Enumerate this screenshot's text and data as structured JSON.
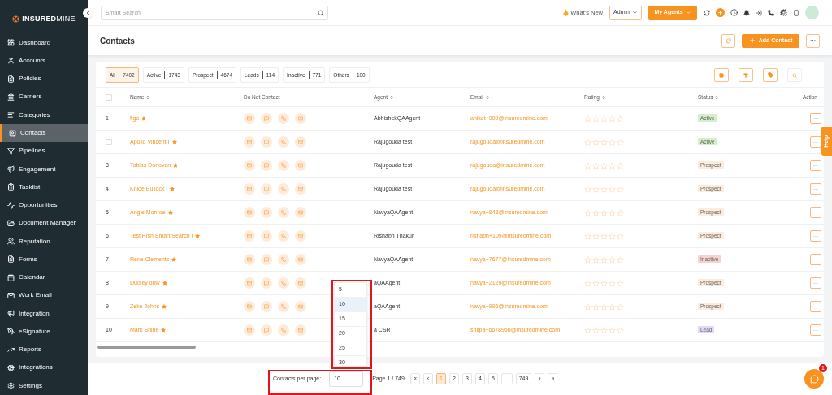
{
  "brand": {
    "name_bold": "INSURED",
    "name_light": "MINE"
  },
  "sidebar": {
    "items": [
      {
        "label": "Dashboard",
        "selected": false
      },
      {
        "label": "Accounts",
        "selected": false
      },
      {
        "label": "Policies",
        "selected": false
      },
      {
        "label": "Carriers",
        "selected": false
      },
      {
        "label": "Categories",
        "selected": false
      },
      {
        "label": "Contacts",
        "selected": true
      },
      {
        "label": "Pipelines",
        "selected": false
      },
      {
        "label": "Engagement",
        "selected": false
      },
      {
        "label": "Tasklist",
        "selected": false
      },
      {
        "label": "Opportunities",
        "selected": false
      },
      {
        "label": "Document Manager",
        "selected": false
      },
      {
        "label": "Reputation",
        "selected": false
      },
      {
        "label": "Forms",
        "selected": false
      },
      {
        "label": "Calendar",
        "selected": false
      },
      {
        "label": "Work Email",
        "selected": false
      },
      {
        "label": "Integration",
        "selected": false
      },
      {
        "label": "eSignature",
        "selected": false
      },
      {
        "label": "Reports",
        "selected": false
      },
      {
        "label": "Integrations",
        "selected": false
      },
      {
        "label": "Settings",
        "selected": false
      }
    ]
  },
  "topbar": {
    "search_placeholder": "Smart Search",
    "whats_new": "What's New",
    "role_select": "Admin",
    "agents_button": "My Agents"
  },
  "page": {
    "title": "Contacts",
    "add_button": "Add Contact",
    "more_button": "···"
  },
  "filters": [
    {
      "label": "All",
      "count": "7402",
      "selected": true
    },
    {
      "label": "Active",
      "count": "1743",
      "selected": false
    },
    {
      "label": "Prospect",
      "count": "4674",
      "selected": false
    },
    {
      "label": "Leads",
      "count": "114",
      "selected": false
    },
    {
      "label": "Inactive",
      "count": "771",
      "selected": false
    },
    {
      "label": "Others",
      "count": "100",
      "selected": false
    }
  ],
  "table": {
    "select_all": {
      "checked": false
    },
    "columns": [
      {
        "label": "Name",
        "sortable": true
      },
      {
        "label": "Do Not Contact",
        "sortable": false
      },
      {
        "label": "Agent",
        "sortable": true
      },
      {
        "label": "Email",
        "sortable": true
      },
      {
        "label": "Rating",
        "sortable": true
      },
      {
        "label": "Status",
        "sortable": true
      },
      {
        "label": "Action",
        "sortable": false
      }
    ],
    "rows": [
      {
        "kind": "number",
        "index": "1",
        "name": "figo",
        "agent": "AbhishekQAAgent",
        "email": "aniket+900@insuredmine.com",
        "stars": 0,
        "status": "Active",
        "color": "#d4f0c8"
      },
      {
        "kind": "checkbox",
        "checked": false,
        "name": "Apollo Vincent I",
        "agent": "Rajugouda test",
        "email": "rajugouda@insuredmine.com",
        "stars": 0,
        "status": "Active",
        "color": "#d4f0c8"
      },
      {
        "kind": "number",
        "index": "3",
        "name": "Tobias Donovan",
        "agent": "Rajugouda test",
        "email": "rajugouda@insuredmine.com",
        "stars": 0,
        "status": "Prospect",
        "color": "#fdebdc"
      },
      {
        "kind": "number",
        "index": "4",
        "name": "Khloe Bullock I",
        "agent": "Rajugouda test",
        "email": "rajugouda@insuredmine.com",
        "stars": 0,
        "status": "Prospect",
        "color": "#fdebdc"
      },
      {
        "kind": "number",
        "index": "5",
        "name": "Angie Monroe",
        "agent": "NavyaQAAgent",
        "email": "navya+943@insuredmine.com",
        "stars": 0,
        "status": "Prospect",
        "color": "#fdebdc"
      },
      {
        "kind": "number",
        "index": "6",
        "name": "Test Rish Smart Search I",
        "agent": "Rishabh Thakur",
        "email": "rishabh+109@insuredmine.com",
        "stars": 0,
        "status": "Prospect",
        "color": "#fdebdc"
      },
      {
        "kind": "number",
        "index": "7",
        "name": "Rene Clements",
        "agent": "NavyaQAAgent",
        "email": "navya+7677@insuredmine.com",
        "stars": 0,
        "status": "Inactive",
        "color": "#f6d3d1"
      },
      {
        "kind": "number",
        "index": "8",
        "name": "Dudley duw",
        "agent": "aQAAgent",
        "email": "navya+2129@insuredmine.com",
        "stars": 0,
        "status": "Prospect",
        "color": "#fdebdc"
      },
      {
        "kind": "number",
        "index": "9",
        "name": "Zeke Johns",
        "agent": "aQAAgent",
        "email": "navya+996@insuredmine.com",
        "stars": 0,
        "status": "Prospect",
        "color": "#fdebdc"
      },
      {
        "kind": "number",
        "index": "10",
        "name": "Mark Shine",
        "agent": "a CSR",
        "email": "shilpa+6678966@insuredmine.com",
        "stars": 0,
        "status": "Lead",
        "color": "#e4d8f7"
      }
    ]
  },
  "page_size_menu": {
    "options": [
      {
        "label": "5",
        "selected": false
      },
      {
        "label": "10",
        "selected": true
      },
      {
        "label": "15",
        "selected": false
      },
      {
        "label": "20",
        "selected": false
      },
      {
        "label": "25",
        "selected": false
      },
      {
        "label": "30",
        "selected": false
      }
    ]
  },
  "footer": {
    "per_page_label": "Contacts per page:",
    "per_page_value": "10",
    "page_info": "Page 1 / 749",
    "pages": [
      {
        "label": "«",
        "selected": false
      },
      {
        "label": "‹",
        "selected": false
      },
      {
        "label": "1",
        "selected": true
      },
      {
        "label": "2",
        "selected": false
      },
      {
        "label": "3",
        "selected": false
      },
      {
        "label": "4",
        "selected": false
      },
      {
        "label": "5",
        "selected": false
      },
      {
        "label": "...",
        "selected": false
      },
      {
        "label": "749",
        "selected": false
      },
      {
        "label": "›",
        "selected": false
      },
      {
        "label": "»",
        "selected": false
      }
    ]
  },
  "help_tab": "Help",
  "chat_badge": "1"
}
